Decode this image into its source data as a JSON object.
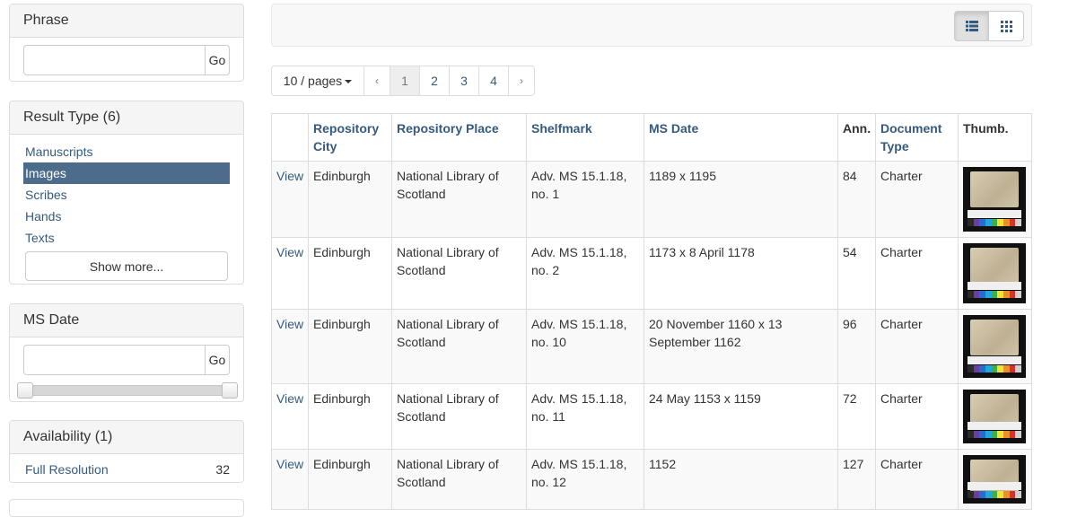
{
  "sidebar": {
    "phrase": {
      "title": "Phrase",
      "go_label": "Go",
      "value": ""
    },
    "result_type": {
      "title": "Result Type (6)",
      "items": [
        {
          "label": "Manuscripts",
          "active": false
        },
        {
          "label": "Images",
          "active": true
        },
        {
          "label": "Scribes",
          "active": false
        },
        {
          "label": "Hands",
          "active": false
        },
        {
          "label": "Texts",
          "active": false
        }
      ],
      "show_more_label": "Show more..."
    },
    "ms_date": {
      "title": "MS Date",
      "go_label": "Go",
      "value": "",
      "slider_range": [
        0,
        1
      ]
    },
    "availability": {
      "title": "Availability (1)",
      "items": [
        {
          "label": "Full Resolution",
          "count": "32"
        }
      ]
    }
  },
  "toolbar": {
    "view_modes": [
      {
        "icon": "list-icon",
        "active": true
      },
      {
        "icon": "grid-icon",
        "active": false
      }
    ]
  },
  "pagination": {
    "per_page_label": "10 / pages",
    "prev": "‹",
    "next": "›",
    "pages": [
      "1",
      "2",
      "3",
      "4"
    ],
    "current": "1"
  },
  "table": {
    "headers": {
      "repository_city": "Repository City",
      "repository_place": "Repository Place",
      "shelfmark": "Shelfmark",
      "ms_date": "MS Date",
      "ann": "Ann.",
      "document_type": "Document Type",
      "thumb": "Thumb."
    },
    "view_label": "View",
    "rows": [
      {
        "city": "Edinburgh",
        "place": "National Library of Scotland",
        "shelfmark": "Adv. MS 15.1.18, no. 1",
        "date": "1189 x 1195",
        "ann": "84",
        "type": "Charter"
      },
      {
        "city": "Edinburgh",
        "place": "National Library of Scotland",
        "shelfmark": "Adv. MS 15.1.18, no. 2",
        "date": "1173 x 8 April 1178",
        "ann": "54",
        "type": "Charter"
      },
      {
        "city": "Edinburgh",
        "place": "National Library of Scotland",
        "shelfmark": "Adv. MS 15.1.18, no. 10",
        "date": "20 November 1160 x 13 September 1162",
        "ann": "96",
        "type": "Charter"
      },
      {
        "city": "Edinburgh",
        "place": "National Library of Scotland",
        "shelfmark": "Adv. MS 15.1.18, no. 11",
        "date": "24 May 1153 x 1159",
        "ann": "72",
        "type": "Charter"
      },
      {
        "city": "Edinburgh",
        "place": "National Library of Scotland",
        "shelfmark": "Adv. MS 15.1.18, no. 12",
        "date": "1152",
        "ann": "127",
        "type": "Charter"
      }
    ]
  },
  "colors": {
    "link": "#355a7e",
    "active_facet": "#4d6b8a",
    "thumb_colorbar": [
      "#2b2b2b",
      "#6a3fa0",
      "#2a6bd1",
      "#22a7d8",
      "#3cae4a",
      "#f0e23a",
      "#e8902a",
      "#d83030",
      "#d0d0d0"
    ]
  }
}
